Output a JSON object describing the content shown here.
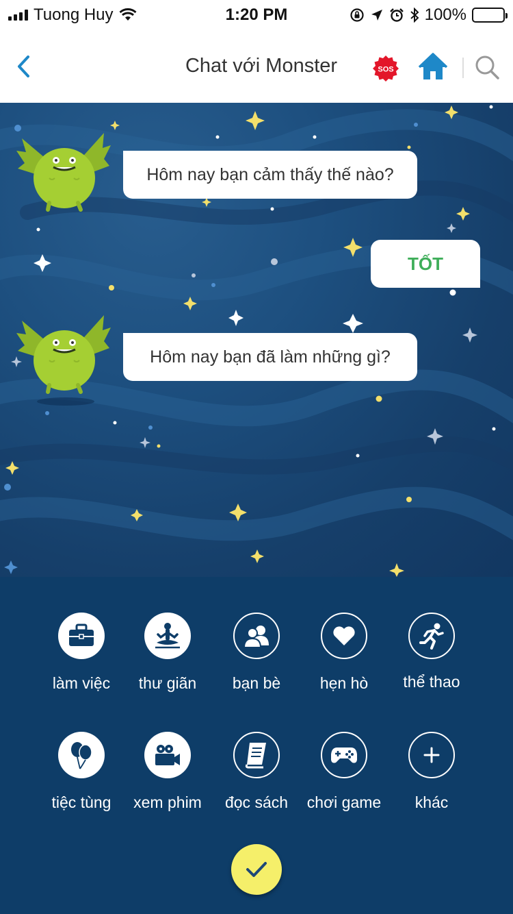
{
  "status_bar": {
    "carrier": "Tuong Huy",
    "time": "1:20 PM",
    "battery": "100%"
  },
  "nav": {
    "title": "Chat với Monster",
    "sos_label": "SOS"
  },
  "chat": {
    "messages": [
      {
        "from": "monster",
        "text": "Hôm nay bạn cảm thấy thế nào?"
      },
      {
        "from": "user",
        "text": "TỐT"
      },
      {
        "from": "monster",
        "text": "Hôm nay bạn đã làm những gì?"
      }
    ]
  },
  "activities": [
    {
      "label": "làm việc",
      "icon": "briefcase-icon"
    },
    {
      "label": "thư giãn",
      "icon": "meditation-icon"
    },
    {
      "label": "bạn bè",
      "icon": "friends-icon"
    },
    {
      "label": "hẹn hò",
      "icon": "heart-icon"
    },
    {
      "label": "thể thao",
      "icon": "running-icon"
    },
    {
      "label": "tiệc tùng",
      "icon": "balloons-icon"
    },
    {
      "label": "xem phim",
      "icon": "video-camera-icon"
    },
    {
      "label": "đọc sách",
      "icon": "book-icon"
    },
    {
      "label": "chơi game",
      "icon": "gamepad-icon"
    },
    {
      "label": "khác",
      "icon": "plus-icon"
    }
  ],
  "colors": {
    "accent_blue": "#1e88c8",
    "sos_red": "#e3162a",
    "user_reply_green": "#3fae5a",
    "confirm_yellow": "#f5ef6a",
    "panel_navy": "#0e3d68",
    "monster_green": "#a5cf33"
  }
}
